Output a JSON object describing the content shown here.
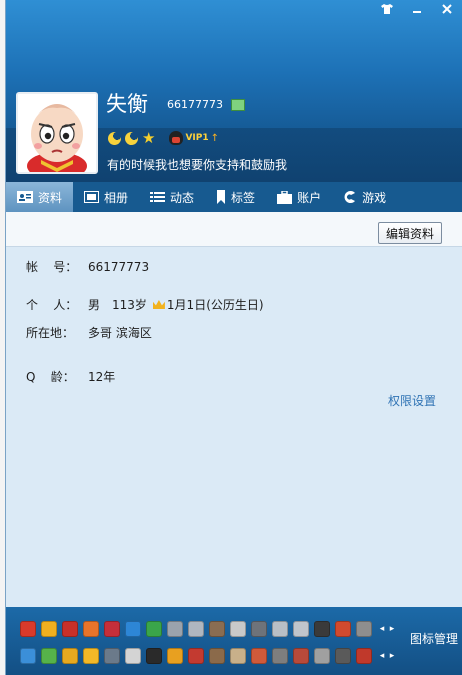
{
  "window": {
    "controls": [
      "shirt-icon",
      "minimize-icon",
      "close-icon"
    ]
  },
  "profile": {
    "name": "失衡",
    "qq_number": "66177773",
    "vip_label": "VIP1",
    "signature": "有的时候我也想要你支持和鼓励我"
  },
  "tabs": [
    {
      "label": "资料",
      "icon": "id-card-icon",
      "active": true
    },
    {
      "label": "相册",
      "icon": "photo-icon",
      "active": false
    },
    {
      "label": "动态",
      "icon": "feed-icon",
      "active": false
    },
    {
      "label": "标签",
      "icon": "bookmark-icon",
      "active": false
    },
    {
      "label": "账户",
      "icon": "briefcase-icon",
      "active": false
    },
    {
      "label": "游戏",
      "icon": "game-icon",
      "active": false
    }
  ],
  "actions": {
    "edit_label": "编辑资料"
  },
  "info": {
    "account_label": "帐    号：",
    "account_value": "66177773",
    "personal_label": "个    人：",
    "gender": "男",
    "age": "113岁",
    "birthday": "1月1日(公历生日)",
    "location_label": "所在地：",
    "location_value": "多哥 滨海区",
    "qage_label": "Q    龄：",
    "qage_value": "12年",
    "permission_link": "权限设置"
  },
  "footer": {
    "manage_label": "图标管理",
    "row1_colors": [
      "#d93a2b",
      "#f0b020",
      "#c8302a",
      "#e8742a",
      "#c62f3a",
      "#2d86d6",
      "#3aa54a",
      "#9aa3ad",
      "#b0b7c0",
      "#8a6d52",
      "#c9c9c9",
      "#6e737a",
      "#b9bfc6",
      "#c0c5cc",
      "#3a3a3a",
      "#d14a2e",
      "#8e8e8e"
    ],
    "row2_colors": [
      "#3b8fd9",
      "#56b34a",
      "#e6a91f",
      "#f3b827",
      "#6b7a8a",
      "#d4d4d4",
      "#2a2a2a",
      "#e8a020",
      "#c33a30",
      "#8b6a4a",
      "#c8b08a",
      "#d05a3a",
      "#7e7e7e",
      "#b84a3a",
      "#a0a0a0",
      "#5a5a5a",
      "#c0392b"
    ]
  }
}
